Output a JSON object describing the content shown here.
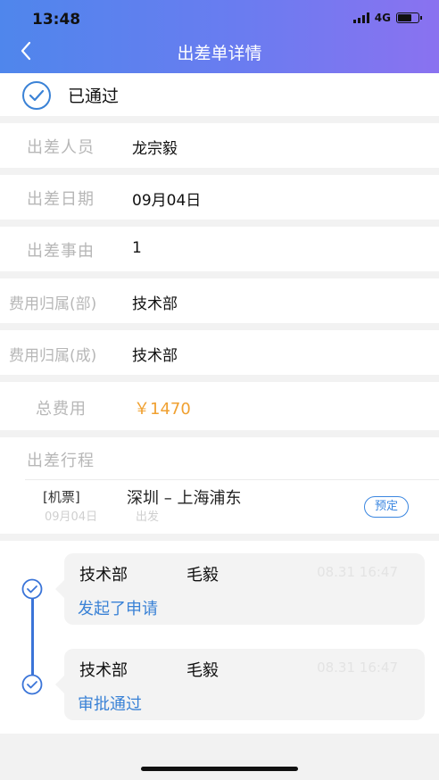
{
  "status_bar": {
    "time": "13:48",
    "network": "4G"
  },
  "header": {
    "title": "出差单详情"
  },
  "approval_status": {
    "text": "已通过"
  },
  "fields": [
    {
      "label": "出差人员",
      "value": "龙宗毅"
    },
    {
      "label": "出差日期",
      "value": "09月04日"
    },
    {
      "label": "出差事由",
      "value": "1"
    },
    {
      "label": "费用归属(部)",
      "value": "技术部"
    },
    {
      "label": "费用归属(成)",
      "value": "技术部"
    }
  ],
  "total": {
    "label": "总费用",
    "value": "￥1470"
  },
  "itinerary": {
    "label": "出差行程",
    "ticket_type": "[机票]",
    "route": "深圳 – 上海浦东",
    "date": "09月04日",
    "trip_status": "出发",
    "book_button": "预定"
  },
  "timeline": [
    {
      "dept": "技术部",
      "name": "毛毅",
      "time": "08.31 16:47",
      "action": "发起了申请"
    },
    {
      "dept": "技术部",
      "name": "毛毅",
      "time": "08.31 16:47",
      "action": "审批通过"
    }
  ],
  "colors": {
    "header_start": "#4f86ec",
    "header_end": "#8a72f0",
    "accent": "#3a82d6",
    "amount": "#f0a030"
  }
}
